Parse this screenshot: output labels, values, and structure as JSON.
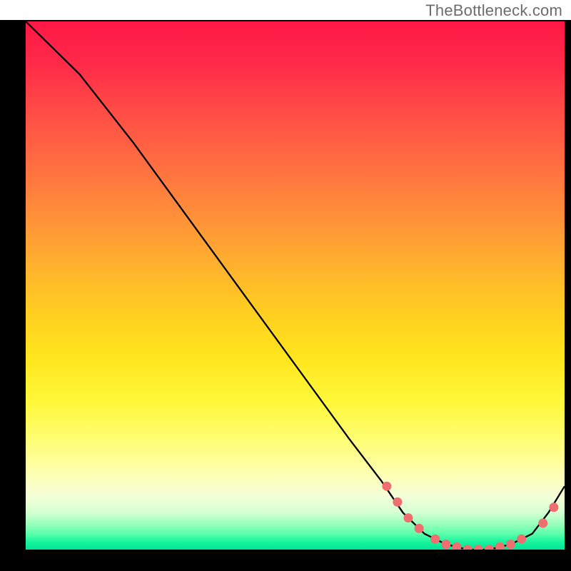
{
  "attribution": "TheBottleneck.com",
  "chart_data": {
    "type": "line",
    "title": "",
    "xlabel": "",
    "ylabel": "",
    "xlim": [
      0,
      100
    ],
    "ylim": [
      0,
      100
    ],
    "series": [
      {
        "name": "bottleneck-curve",
        "x": [
          0,
          4,
          10,
          20,
          30,
          40,
          50,
          60,
          66,
          70,
          74,
          78,
          82,
          86,
          90,
          94,
          97,
          100
        ],
        "y": [
          100,
          96,
          90,
          77,
          63,
          49,
          35,
          21,
          13,
          7,
          3,
          1,
          0,
          0,
          1,
          3,
          7,
          12
        ]
      }
    ],
    "markers": {
      "name": "highlighted-points",
      "x": [
        67,
        69,
        71,
        73,
        76,
        78,
        80,
        82,
        84,
        86,
        88,
        90,
        92,
        96,
        98
      ],
      "y": [
        12,
        9,
        6,
        4,
        2,
        1,
        0.5,
        0,
        0,
        0,
        0.5,
        1,
        2,
        5,
        8
      ]
    },
    "background_gradient": {
      "top": "#ff1846",
      "middle": "#ffe61e",
      "bottom": "#00e497"
    }
  }
}
